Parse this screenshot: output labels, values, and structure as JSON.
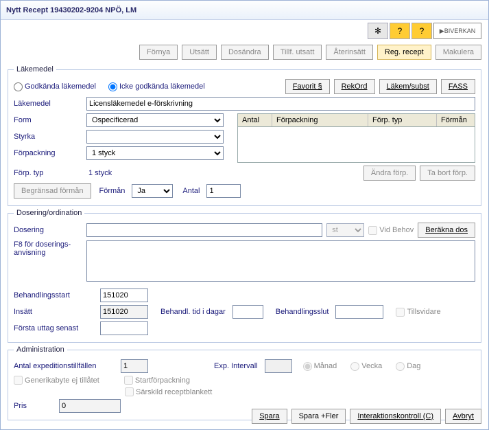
{
  "title": "Nytt Recept  19430202-9204 NPÖ, LM",
  "toolbar": {
    "fornya": "Förnya",
    "utsatt": "Utsätt",
    "dosandra": "Dosändra",
    "tillf_utsatt": "Tillf. utsatt",
    "aterinsatt": "Återinsätt",
    "reg_recept": "Reg. recept",
    "makulera": "Makulera"
  },
  "topicon_label": "BIVERKAN",
  "lakemedel": {
    "legend": "Läkemedel",
    "radio_godkanda": "Godkända läkemedel",
    "radio_icke": "Icke godkända läkemedel",
    "favorit": "Favorit §",
    "rekord": "RekOrd",
    "lakem_subst": "Läkem/subst",
    "fass": "FASS",
    "lbl_lakemedel": "Läkemedel",
    "val_lakemedel": "Licensläkemedel e-förskrivning",
    "lbl_form": "Form",
    "val_form": "Ospecificerad",
    "lbl_styrka": "Styrka",
    "val_styrka": "",
    "lbl_forpackning": "Förpackning",
    "val_forpackning": "1 styck",
    "lbl_forp_typ": "Förp. typ",
    "val_forp_typ": "1 styck",
    "grid": {
      "antal": "Antal",
      "forpackning": "Förpackning",
      "forp_typ": "Förp. typ",
      "forman": "Förmån"
    },
    "andra_forp": "Ändra förp.",
    "ta_bort_forp": "Ta bort förp.",
    "begransad_forman": "Begränsad förmån",
    "lbl_forman": "Förmån",
    "val_forman": "Ja",
    "lbl_antal": "Antal",
    "val_antal": "1"
  },
  "dosering": {
    "legend": "Dosering/ordination",
    "lbl_dosering": "Dosering",
    "val_dosering": "",
    "unit": "st",
    "vid_behov": "Vid Behov",
    "berakna": "Beräkna dos",
    "hint1": "F8 för doserings-",
    "hint2": "anvisning",
    "lbl_behstart": "Behandlingsstart",
    "val_behstart": "151020",
    "lbl_insatt": "Insätt",
    "val_insatt": "151020",
    "lbl_behtid": "Behandl. tid i dagar",
    "val_behtid": "",
    "lbl_behslut": "Behandlingsslut",
    "val_behslut": "",
    "tillsvidare": "Tillsvidare",
    "lbl_forsta": "Första uttag senast",
    "val_forsta": ""
  },
  "admin": {
    "legend": "Administration",
    "lbl_exp_tillf": "Antal expeditionstillfällen",
    "val_exp_tillf": "1",
    "lbl_exp_intervall": "Exp. Intervall",
    "r_manad": "Månad",
    "r_vecka": "Vecka",
    "r_dag": "Dag",
    "c_generika": "Generikabyte ej tillåtet",
    "c_startforp": "Startförpackning",
    "c_sarskild": "Särskild receptblankett",
    "lbl_pris": "Pris",
    "val_pris": "0"
  },
  "footer": {
    "spara": "Spara",
    "spara_fler": "Spara +Fler",
    "interaktion": "Interaktionskontroll (C)",
    "avbryt": "Avbryt"
  }
}
